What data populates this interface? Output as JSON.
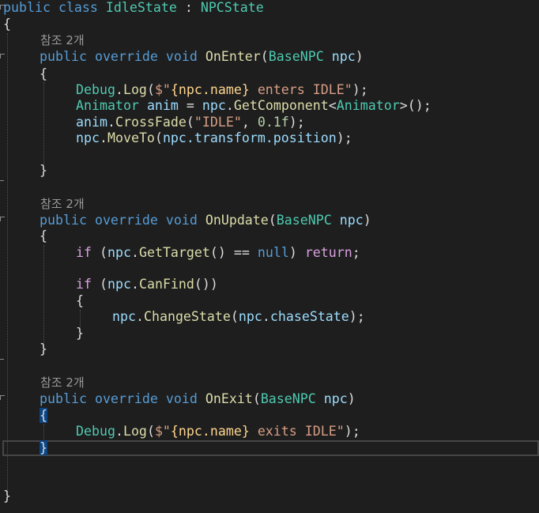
{
  "editor": {
    "class_decl": {
      "kw1": "public",
      "kw2": "class",
      "name": "IdleState",
      "colon": ":",
      "base": "NPCState"
    },
    "open_brace": "{",
    "close_brace": "}",
    "ref_count_label": "참조 2개",
    "kw_public": "public",
    "kw_override": "override",
    "kw_void": "void",
    "param_type": "BaseNPC",
    "param_name": "npc",
    "methods": {
      "on_enter": {
        "name": "OnEnter",
        "lines": {
          "debug_log": {
            "obj": "Debug",
            "method": "Log",
            "prefix": "$\"",
            "expr": "{npc.name}",
            "rest": " enters IDLE",
            "suffix": "\""
          },
          "anim_decl": {
            "type": "Animator",
            "var": "anim",
            "obj": "npc",
            "method": "GetComponent",
            "generic": "Animator"
          },
          "crossfade": {
            "obj": "anim",
            "method": "CrossFade",
            "arg1": "\"IDLE\"",
            "arg2": "0.1f"
          },
          "moveto": {
            "obj": "npc",
            "method": "MoveTo",
            "arg": "npc.transform.position"
          }
        }
      },
      "on_update": {
        "name": "OnUpdate",
        "lines": {
          "if1": {
            "kw": "if",
            "obj": "npc",
            "method": "GetTarget",
            "op": "==",
            "null": "null",
            "ret": "return"
          },
          "if2": {
            "kw": "if",
            "obj": "npc",
            "method": "CanFind"
          },
          "change_state": {
            "obj": "npc",
            "method": "ChangeState",
            "arg_obj": "npc",
            "arg_field": "chaseState"
          }
        }
      },
      "on_exit": {
        "name": "OnExit",
        "lines": {
          "debug_log": {
            "obj": "Debug",
            "method": "Log",
            "prefix": "$\"",
            "expr": "{npc.name}",
            "rest": " exits IDLE",
            "suffix": "\""
          }
        }
      }
    }
  }
}
